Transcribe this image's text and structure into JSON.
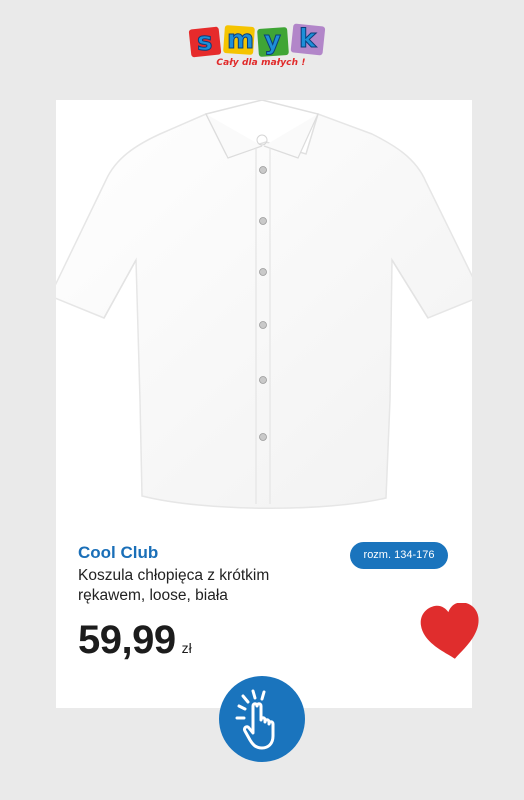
{
  "logo": {
    "letters": [
      "s",
      "m",
      "y",
      "k"
    ],
    "tagline": "Cały dla małych !",
    "colors": [
      "#1d8fd8",
      "#e62b2b",
      "#f5c400",
      "#8bc34a"
    ]
  },
  "product": {
    "brand": "Cool Club",
    "title": "Koszula chłopięca z krótkim rękawem, loose, biała",
    "size_label": "rozm. 134-176",
    "price": "59,99",
    "currency": "zł",
    "image_icon": "white-shirt-image"
  },
  "actions": {
    "favorite_icon": "heart-icon",
    "tap_icon": "tap-hand-icon"
  },
  "colors": {
    "accent": "#1a74bd",
    "brand_text": "#1a6fb8",
    "heart": "#e02d2d",
    "background": "#eaeaea"
  }
}
